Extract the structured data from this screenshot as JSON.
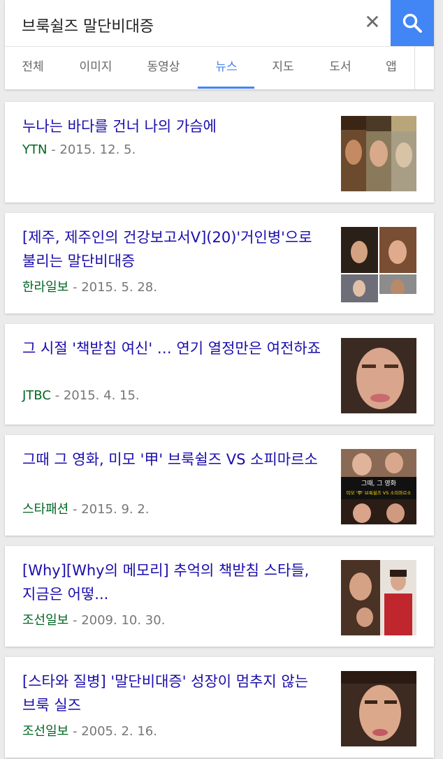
{
  "search": {
    "query": "브룩쉴즈 말단비대증",
    "clear_icon": "close-icon",
    "search_icon": "search-icon",
    "accent": "#4285f4"
  },
  "tabs": [
    {
      "label": "전체",
      "active": false
    },
    {
      "label": "이미지",
      "active": false
    },
    {
      "label": "동영상",
      "active": false
    },
    {
      "label": "뉴스",
      "active": true
    },
    {
      "label": "지도",
      "active": false
    },
    {
      "label": "도서",
      "active": false
    },
    {
      "label": "앱",
      "active": false
    }
  ],
  "results": [
    {
      "title": "누나는 바다를 건너 나의 가슴에",
      "source": "YTN",
      "date": "2015. 12. 5."
    },
    {
      "title": "[제주, 제주인의 건강보고서V](20)'거인병'으로 불리는 말단비대증",
      "source": "한라일보",
      "date": "2015. 5. 28."
    },
    {
      "title": "그 시절 '책받침 여신' … 연기 열정만은 여전하죠",
      "source": "JTBC",
      "date": "2015. 4. 15."
    },
    {
      "title": "그때 그 영화, 미모 '甲' 브룩쉴즈 VS 소피마르소",
      "source": "스타패션",
      "date": "2015. 9. 2.",
      "thumb_text_1": "그때, 그 영화",
      "thumb_text_2": "미모 '甲' 브룩쉴즈 VS 소피마르소"
    },
    {
      "title": "[Why][Why의 메모리] 추억의 책받침 스타들, 지금은 어떻...",
      "source": "조선일보",
      "date": "2009. 10. 30."
    },
    {
      "title": "[스타와 질병] '말단비대증' 성장이 멈추지 않는 브룩 실즈",
      "source": "조선일보",
      "date": "2005. 2. 16."
    }
  ],
  "colors": {
    "title_link": "#1a0dab",
    "source": "#006621",
    "date": "#777777"
  }
}
